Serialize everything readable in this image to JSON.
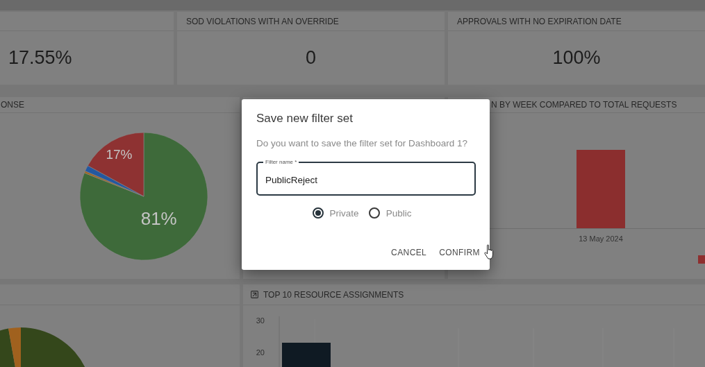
{
  "kpi_cards": [
    {
      "value": "17.55%"
    },
    {
      "title": "SOD VIOLATIONS WITH AN OVERRIDE",
      "value": "0"
    },
    {
      "title": "APPROVALS WITH NO EXPIRATION DATE",
      "value": "100%"
    }
  ],
  "chart_row": {
    "left_panel": {
      "title": "ONSE",
      "chart_data": {
        "type": "pie",
        "values": [
          81,
          0.5,
          1.5,
          17
        ],
        "value_labels": [
          "81%",
          null,
          null,
          "17%"
        ]
      }
    },
    "right_panel": {
      "title": "N BY WEEK COMPARED TO TOTAL REQUESTS",
      "x_labels": [
        "13 May 2024"
      ]
    }
  },
  "bottom_row": {
    "right_panel": {
      "title": "TOP 10 RESOURCE ASSIGNMENTS",
      "y_tick_labels": [
        "30",
        "20"
      ]
    }
  },
  "dialog": {
    "title": "Save new filter set",
    "message": "Do you want to save the filter set for Dashboard 1?",
    "field": {
      "label": "Filter name *",
      "value": "PublicReject"
    },
    "options": [
      {
        "label": "Private",
        "selected": true
      },
      {
        "label": "Public",
        "selected": false
      }
    ],
    "buttons": [
      "CANCEL",
      "CONFIRM"
    ]
  }
}
